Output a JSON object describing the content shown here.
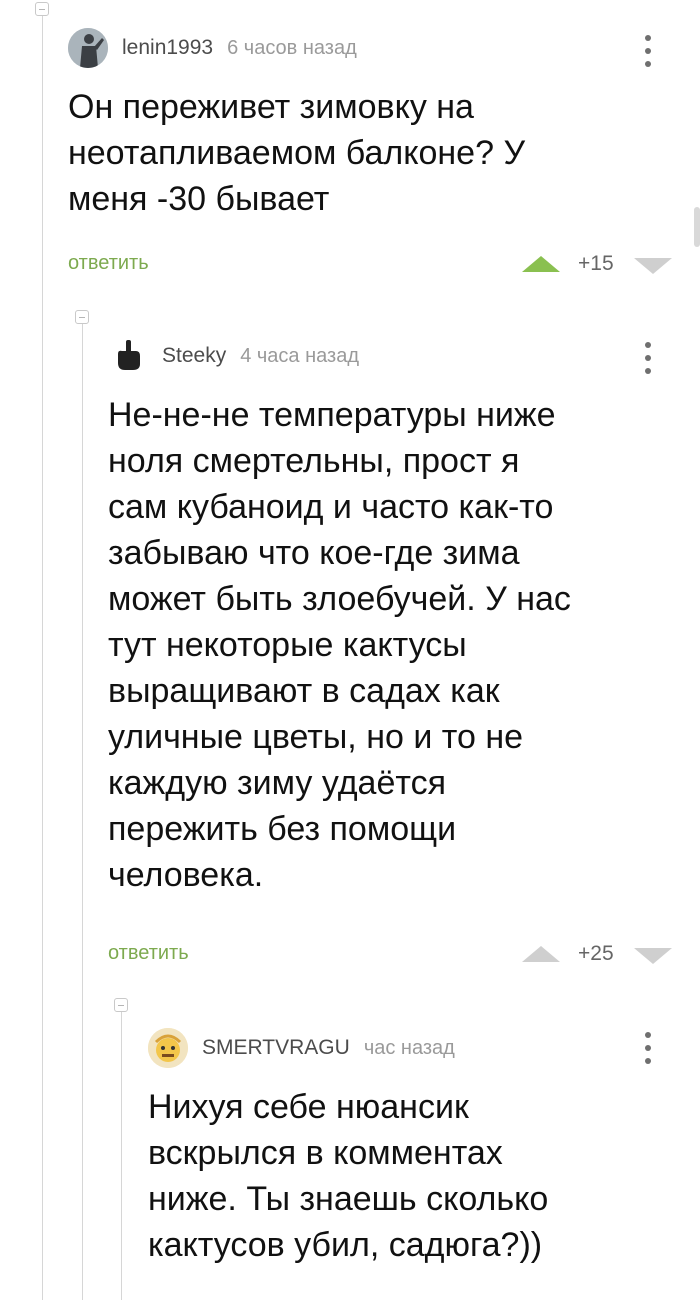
{
  "comments": [
    {
      "username": "lenin1993",
      "time": "6 часов назад",
      "text": "Он переживет зимовку на\nнеотапливаемом балконе? У\nменя -30 бывает",
      "reply_label": "ответить",
      "rating": "+15",
      "upvoted": true,
      "avatar_icon": "statue-avatar-icon"
    },
    {
      "username": "Steeky",
      "time": "4 часа назад",
      "text": "Не-не-не температуры ниже\nноля смертельны, прост я\nсам кубаноид и часто как-то\nзабываю что кое-где зима\nможет быть злоебучей. У нас\nтут некоторые кактусы\nвыращивают в садах как\nуличные цветы, но и то не\nкаждую зиму удаётся\nпережить без помощи\nчеловека.",
      "reply_label": "ответить",
      "rating": "+25",
      "upvoted": false,
      "avatar_icon": "middle-finger-hand-icon"
    },
    {
      "username": "SMERTVRAGU",
      "time": "час назад",
      "text": "Нихуя себе нюансик\nвскрылся в комментах\nниже. Ты знаешь сколько\nкактусов убил, садюга?))",
      "avatar_icon": "cartoon-face-avatar-icon"
    }
  ],
  "colors": {
    "accent_green": "#8ac050",
    "reply_green": "#7daa4f",
    "thread_line": "#d6d6d6"
  }
}
